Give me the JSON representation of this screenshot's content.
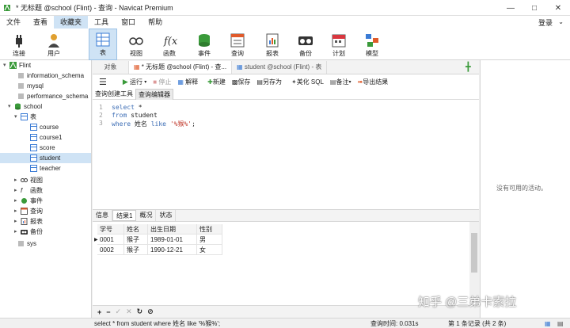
{
  "window": {
    "title": "* 无标题 @school (Flint) - 查询 - Navicat Premium"
  },
  "menu": [
    "文件",
    "查看",
    "收藏夹",
    "工具",
    "窗口",
    "帮助"
  ],
  "login_label": "登录",
  "toolbar": [
    {
      "label": "连接",
      "icon": "plug-icon"
    },
    {
      "label": "用户",
      "icon": "user-icon"
    },
    {
      "label": "表",
      "icon": "table-icon"
    },
    {
      "label": "视图",
      "icon": "view-icon"
    },
    {
      "label": "函数",
      "icon": "function-icon"
    },
    {
      "label": "事件",
      "icon": "event-icon"
    },
    {
      "label": "查询",
      "icon": "query-icon"
    },
    {
      "label": "报表",
      "icon": "report-icon"
    },
    {
      "label": "备份",
      "icon": "backup-icon"
    },
    {
      "label": "计划",
      "icon": "calendar-icon"
    },
    {
      "label": "模型",
      "icon": "model-icon"
    }
  ],
  "tree": {
    "root": "Flint",
    "databases": [
      "information_schema",
      "mysql",
      "performance_schema"
    ],
    "school": "school",
    "tables_label": "表",
    "tables": [
      "course",
      "course1",
      "score",
      "student",
      "teacher"
    ],
    "others": [
      "视图",
      "函数",
      "事件",
      "查询",
      "报表",
      "备份"
    ],
    "sys": "sys"
  },
  "tabs": [
    "对象",
    "* 无标题 @school (Flint) - 查...",
    "student @school (Flint) - 表"
  ],
  "editbar": {
    "run": "运行",
    "stop": "停止",
    "explain": "解释",
    "new": "新建",
    "save": "保存",
    "save_as": "另存为",
    "beautify": "美化 SQL",
    "note": "备注",
    "export": "导出结果"
  },
  "subtabs": [
    "查询创建工具",
    "查询编辑器"
  ],
  "code": {
    "l1": "1",
    "l2": "2",
    "l3": "3",
    "kw_select": "select",
    "star": " *",
    "kw_from": "from",
    "table": " student",
    "kw_where": "where",
    "field": " 姓名 ",
    "kw_like": "like",
    "pattern": " '%猴%'",
    "semi": ";"
  },
  "result_tabs": [
    "信息",
    "结果1",
    "概况",
    "状态"
  ],
  "result": {
    "columns": [
      "学号",
      "姓名",
      "出生日期",
      "性别"
    ],
    "rows": [
      [
        "0001",
        "猴子",
        "1989-01-01",
        "男"
      ],
      [
        "0002",
        "猴子",
        "1990-12-21",
        "女"
      ]
    ]
  },
  "right_panel": {
    "empty_text": "没有可用的活动。"
  },
  "status": {
    "sql": "select * from student where 姓名 like '%猴%';",
    "time": "查询时间: 0.031s",
    "record": "第 1 条记录 (共 2 条)"
  },
  "watermark": "知乎 @三弟卡索拉"
}
